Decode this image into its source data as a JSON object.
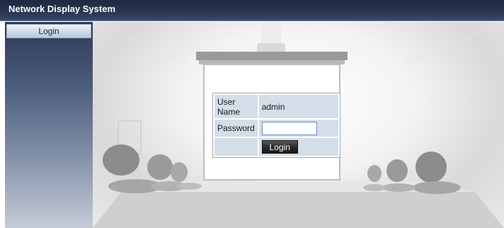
{
  "header": {
    "title": "Network Display System"
  },
  "sidebar": {
    "items": [
      {
        "label": "Login"
      }
    ]
  },
  "login_form": {
    "user_name_label": "User Name",
    "user_name_value": "admin",
    "password_label": "Password",
    "password_value": "",
    "login_button_label": "Login"
  },
  "colors": {
    "titlebar": "#2a3652",
    "sidebar_top": "#2d3a56",
    "form_cell": "#d3dee9",
    "input_border": "#6a8fc7"
  }
}
